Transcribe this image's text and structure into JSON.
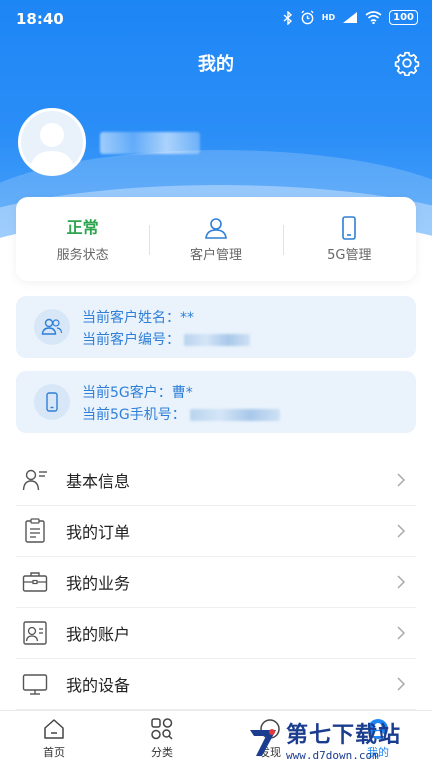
{
  "status_bar": {
    "time": "18:40",
    "battery": "100",
    "network": "HD"
  },
  "header": {
    "title": "我的"
  },
  "stats": [
    {
      "value": "正常",
      "label": "服务状态"
    },
    {
      "label": "客户管理"
    },
    {
      "label": "5G管理"
    }
  ],
  "customer_card": {
    "name_label": "当前客户姓名：",
    "name_value": "**",
    "number_label": "当前客户编号："
  },
  "fiveg_card": {
    "customer_label": "当前5G客户：",
    "customer_value": "曹*",
    "phone_label": "当前5G手机号："
  },
  "menu": [
    {
      "label": "基本信息",
      "icon": "user-info-icon"
    },
    {
      "label": "我的订单",
      "icon": "clipboard-icon"
    },
    {
      "label": "我的业务",
      "icon": "briefcase-icon"
    },
    {
      "label": "我的账户",
      "icon": "id-card-icon"
    },
    {
      "label": "我的设备",
      "icon": "monitor-icon"
    }
  ],
  "bottom_nav": [
    {
      "label": "首页",
      "icon": "home-icon"
    },
    {
      "label": "分类",
      "icon": "category-icon"
    },
    {
      "label": "发现",
      "icon": "discover-icon"
    },
    {
      "label": "我的",
      "icon": "profile-icon"
    }
  ],
  "watermark": {
    "name": "第七下载站",
    "url": "www.d7down.com"
  },
  "colors": {
    "primary": "#1d86f5",
    "status_ok": "#2ea44f",
    "info_text": "#2f7fd6",
    "info_bg": "#eaf3fc"
  }
}
